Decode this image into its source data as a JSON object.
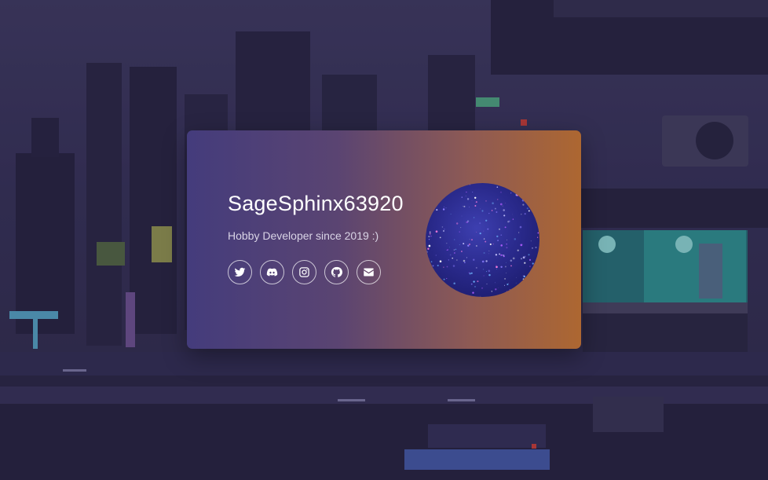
{
  "profile": {
    "username": "SageSphinx63920",
    "tagline": "Hobby Developer since 2019 :)",
    "avatar_icon": "galaxy-avatar"
  },
  "socials": [
    {
      "name": "twitter",
      "icon": "twitter-icon"
    },
    {
      "name": "discord",
      "icon": "discord-icon"
    },
    {
      "name": "instagram",
      "icon": "instagram-icon"
    },
    {
      "name": "github",
      "icon": "github-icon"
    },
    {
      "name": "email",
      "icon": "mail-icon"
    }
  ],
  "colors": {
    "card_gradient_start": "#443c7c",
    "card_gradient_end": "#ad6731",
    "background": "#3a355a",
    "text": "#ffffff"
  }
}
